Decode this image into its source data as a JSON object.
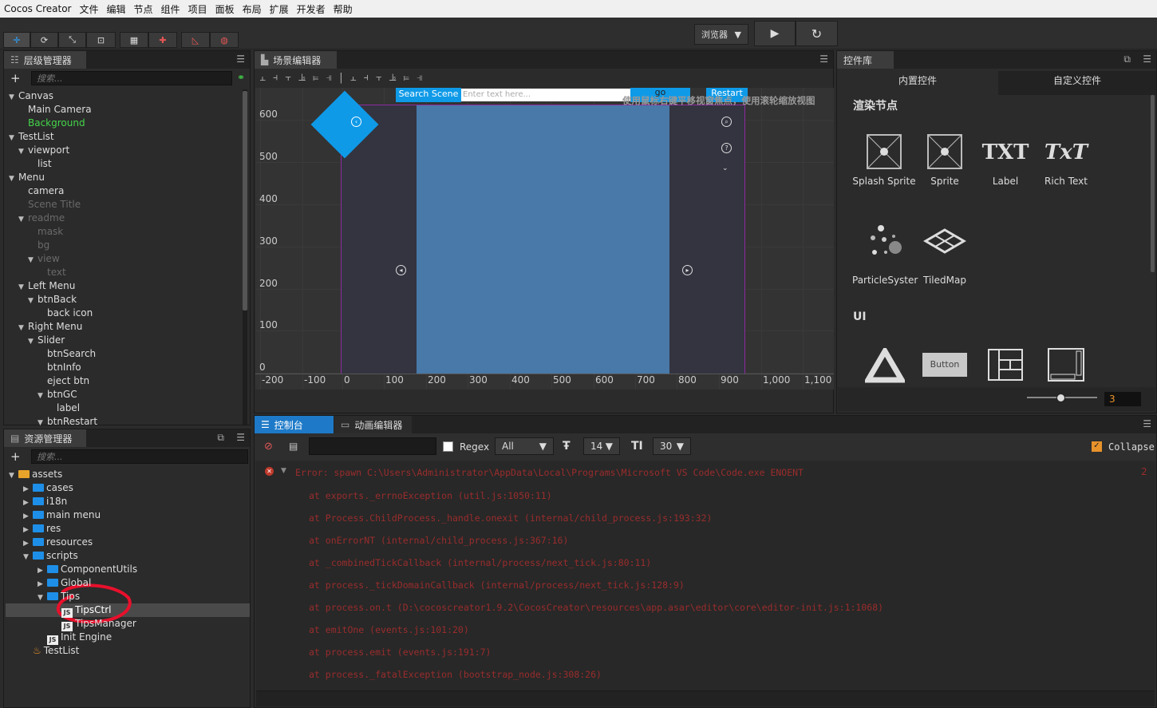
{
  "menubar": {
    "app": "Cocos Creator",
    "items": [
      "文件",
      "编辑",
      "节点",
      "组件",
      "项目",
      "面板",
      "布局",
      "扩展",
      "开发者",
      "帮助"
    ]
  },
  "toolbar": {
    "preview_select": "浏览器",
    "play_icon": "play-icon",
    "refresh_icon": "refresh-icon"
  },
  "hierarchy": {
    "title": "层级管理器",
    "search_placeholder": "搜索...",
    "nodes": [
      {
        "label": "Canvas",
        "arrow": "▼",
        "state": "normal"
      },
      {
        "label": "Main Camera",
        "arrow": "",
        "state": "normal"
      },
      {
        "label": "Background",
        "arrow": "",
        "state": "green"
      },
      {
        "label": "TestList",
        "arrow": "▼",
        "state": "normal"
      },
      {
        "label": "viewport",
        "arrow": "▼",
        "state": "normal"
      },
      {
        "label": "list",
        "arrow": "",
        "state": "normal"
      },
      {
        "label": "Menu",
        "arrow": "▼",
        "state": "normal"
      },
      {
        "label": "camera",
        "arrow": "",
        "state": "normal"
      },
      {
        "label": "Scene Title",
        "arrow": "",
        "state": "dim"
      },
      {
        "label": "readme",
        "arrow": "▼",
        "state": "dim"
      },
      {
        "label": "mask",
        "arrow": "",
        "state": "dim"
      },
      {
        "label": "bg",
        "arrow": "",
        "state": "dim"
      },
      {
        "label": "view",
        "arrow": "▼",
        "state": "dim"
      },
      {
        "label": "text",
        "arrow": "",
        "state": "dim"
      },
      {
        "label": "Left Menu",
        "arrow": "▼",
        "state": "normal"
      },
      {
        "label": "btnBack",
        "arrow": "▼",
        "state": "normal"
      },
      {
        "label": "back icon",
        "arrow": "",
        "state": "normal"
      },
      {
        "label": "Right Menu",
        "arrow": "▼",
        "state": "normal"
      },
      {
        "label": "Slider",
        "arrow": "▼",
        "state": "normal"
      },
      {
        "label": "btnSearch",
        "arrow": "",
        "state": "normal"
      },
      {
        "label": "btnInfo",
        "arrow": "",
        "state": "normal"
      },
      {
        "label": "eject btn",
        "arrow": "",
        "state": "normal"
      },
      {
        "label": "btnGC",
        "arrow": "▼",
        "state": "normal"
      },
      {
        "label": "label",
        "arrow": "",
        "state": "normal"
      },
      {
        "label": "btnRestart",
        "arrow": "▼",
        "state": "normal"
      }
    ]
  },
  "assets": {
    "title": "资源管理器",
    "search_placeholder": "搜索...",
    "items": [
      {
        "label": "assets",
        "arrow": "▼",
        "type": "root"
      },
      {
        "label": "cases",
        "arrow": "▶",
        "type": "folder"
      },
      {
        "label": "i18n",
        "arrow": "▶",
        "type": "folder"
      },
      {
        "label": "main menu",
        "arrow": "▶",
        "type": "folder"
      },
      {
        "label": "res",
        "arrow": "▶",
        "type": "folder"
      },
      {
        "label": "resources",
        "arrow": "▶",
        "type": "folder"
      },
      {
        "label": "scripts",
        "arrow": "▼",
        "type": "folder"
      },
      {
        "label": "ComponentUtils",
        "arrow": "▶",
        "type": "folder"
      },
      {
        "label": "Global",
        "arrow": "▶",
        "type": "folder"
      },
      {
        "label": "Tips",
        "arrow": "▼",
        "type": "folder"
      },
      {
        "label": "TipsCtrl",
        "arrow": "",
        "type": "js"
      },
      {
        "label": "TipsManager",
        "arrow": "",
        "type": "js"
      },
      {
        "label": "Init Engine",
        "arrow": "",
        "type": "js"
      },
      {
        "label": "TestList",
        "arrow": "",
        "type": "scene"
      }
    ]
  },
  "scene": {
    "title": "场景编辑器",
    "search_button": "Search Scene",
    "search_placeholder": "Enter text here...",
    "go_button": "go",
    "restart_button": "Restart",
    "hint": "使用鼠标右键平移视窗焦点，使用滚轮缩放视图",
    "y_ticks": [
      "600",
      "500",
      "400",
      "300",
      "200",
      "100",
      "0"
    ],
    "x_ticks": [
      "-200",
      "-100",
      "0",
      "100",
      "200",
      "300",
      "400",
      "500",
      "600",
      "700",
      "800",
      "900",
      "1,000",
      "1,100"
    ]
  },
  "controls": {
    "title": "控件库",
    "tab_builtin": "内置控件",
    "tab_custom": "自定义控件",
    "section_render": "渲染节点",
    "section_ui": "UI",
    "render_items": [
      "Splash Sprite",
      "Sprite",
      "Label",
      "Rich Text",
      "ParticleSyster",
      "TiledMap"
    ],
    "label_icon_text": "TXT",
    "richtext_icon_text": "TxT",
    "button_icon_text": "Button",
    "zoom_value": "3"
  },
  "console": {
    "tab_console": "控制台",
    "tab_anim": "动画编辑器",
    "regex_label": "Regex",
    "level_select": "All",
    "font_size": "14",
    "line_count": "30",
    "collapse_label": "Collapse",
    "error_count": "2",
    "error_main": "Error: spawn C:\\Users\\Administrator\\AppData\\Local\\Programs\\Microsoft VS Code\\Code.exe ENOENT",
    "stack": [
      "at exports._errnoException  (util.js:1050:11)",
      "at Process.ChildProcess._handle.onexit  (internal/child_process.js:193:32)",
      "at onErrorNT  (internal/child_process.js:367:16)",
      "at _combinedTickCallback  (internal/process/next_tick.js:80:11)",
      "at process._tickDomainCallback  (internal/process/next_tick.js:128:9)",
      "at process.on.t  (D:\\cocoscreator1.9.2\\CocosCreator\\resources\\app.asar\\editor\\core\\editor-init.js:1:1068)",
      "at emitOne  (events.js:101:20)",
      "at process.emit  (events.js:191:7)",
      "at process._fatalException  (bootstrap_node.js:308:26)"
    ]
  },
  "colors": {
    "accent": "#0f9ae8",
    "canvas_bg": "#333440",
    "content_bg": "#4879a8",
    "frame": "#8e2a9e",
    "error": "#9a2c2c",
    "annotation": "#e8102c"
  }
}
